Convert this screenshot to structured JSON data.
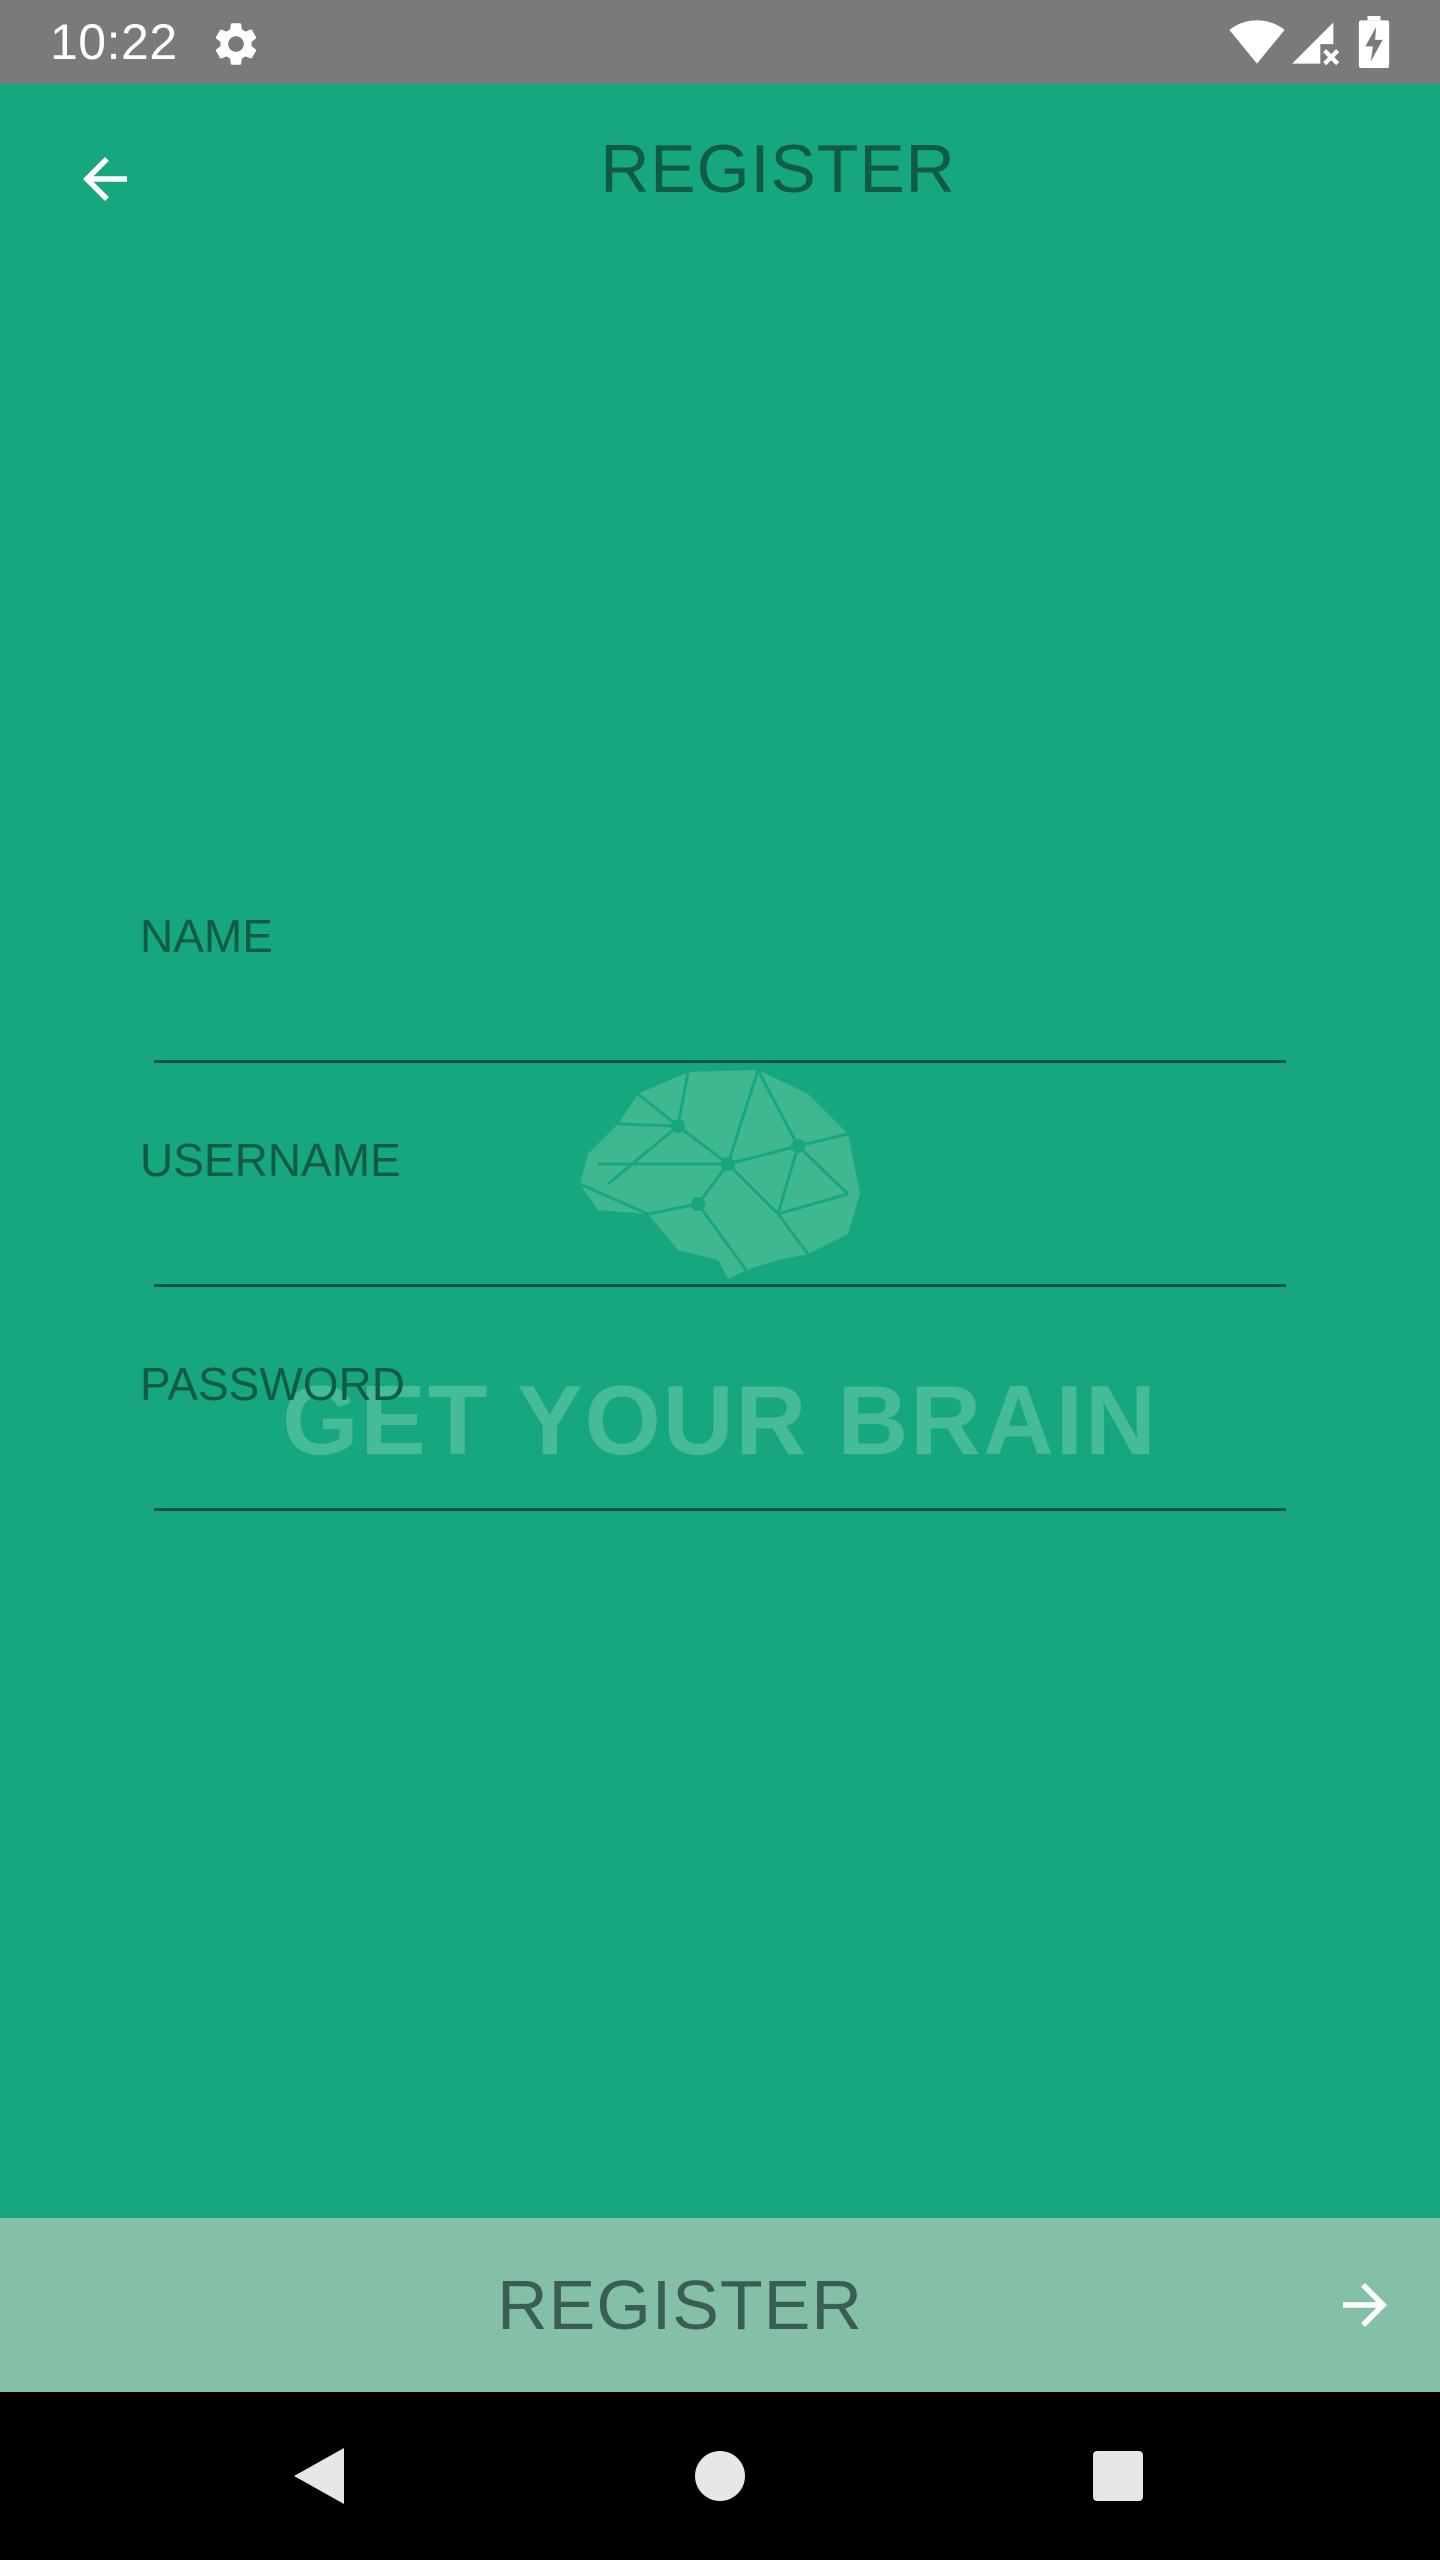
{
  "status_bar": {
    "time": "10:22",
    "icons": [
      "gear-icon",
      "wifi-icon",
      "cell-signal-icon",
      "battery-charging-icon"
    ]
  },
  "app_bar": {
    "title": "REGISTER",
    "back_icon": "arrow-left-icon"
  },
  "watermark": {
    "icon": "brain-icon",
    "text": "GET YOUR BRAIN"
  },
  "form": {
    "name": {
      "label": "NAME",
      "value": ""
    },
    "username": {
      "label": "USERNAME",
      "value": ""
    },
    "password": {
      "label": "PASSWORD",
      "value": ""
    }
  },
  "register_bar": {
    "label": "REGISTER",
    "icon": "arrow-right-icon"
  },
  "nav_bar": {
    "icons": [
      "nav-back-icon",
      "nav-home-icon",
      "nav-recents-icon"
    ]
  },
  "colors": {
    "background": "#17a77e",
    "status_bar": "#7a7a7a",
    "title_text": "#0f5b45",
    "register_bar": "#84bfa8",
    "register_text": "#3a5e52",
    "watermark": "#46bb98",
    "nav_bar": "#000000"
  }
}
